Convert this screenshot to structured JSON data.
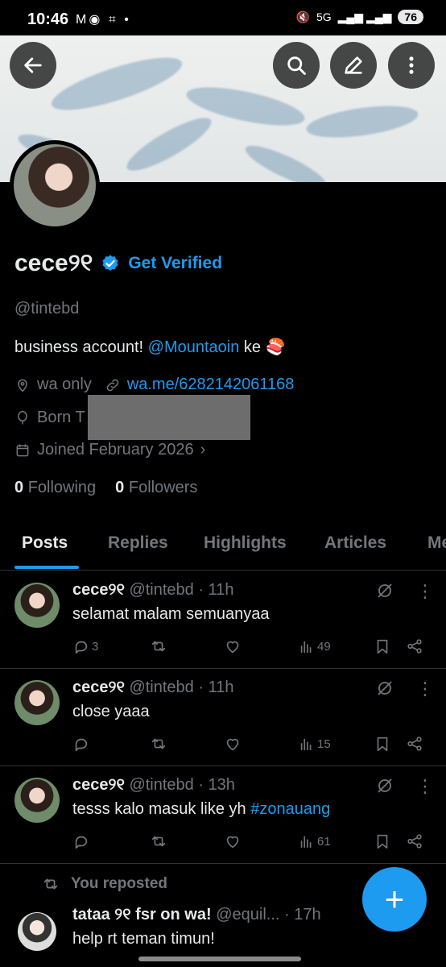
{
  "status_bar": {
    "time": "10:46",
    "left_icons": "M◉ ⌗ •",
    "network": "5G",
    "signal": "▂▄▆ ▂▄▆",
    "battery": "76"
  },
  "profile": {
    "name": "cece୨୧",
    "get_verified": "Get Verified",
    "handle": "@tintebd",
    "bio_prefix": "business account! ",
    "bio_mention": "@Mountaoin",
    "bio_suffix": " ke 🍣",
    "location": "wa only",
    "website": "wa.me/6282142061168",
    "born": "Born T",
    "joined": "Joined February 2026",
    "following_count": "0",
    "following_label": "Following",
    "followers_count": "0",
    "followers_label": "Followers"
  },
  "tabs": [
    "Posts",
    "Replies",
    "Highlights",
    "Articles",
    "Me"
  ],
  "posts": [
    {
      "name": "cece୨୧",
      "meta": "@tintebd · 11h",
      "text": "selamat malam semuanyaa",
      "text_tag": "",
      "replies": "3",
      "views": "49"
    },
    {
      "name": "cece୨୧",
      "meta": "@tintebd · 11h",
      "text": "close yaaa",
      "text_tag": "",
      "replies": "",
      "views": "15"
    },
    {
      "name": "cece୨୧",
      "meta": "@tintebd · 13h",
      "text": "tesss kalo masuk like yh ",
      "text_tag": "#zonauang",
      "replies": "",
      "views": "61"
    }
  ],
  "repost": {
    "label": "You reposted",
    "name": "tataa ୨୧ fsr on wa!",
    "meta": "@equil... · 17h",
    "text": "help rt teman timun!"
  },
  "colors": {
    "accent": "#1d9bf0",
    "muted": "#71767b",
    "text": "#e7e9ea",
    "bg": "#000000"
  }
}
